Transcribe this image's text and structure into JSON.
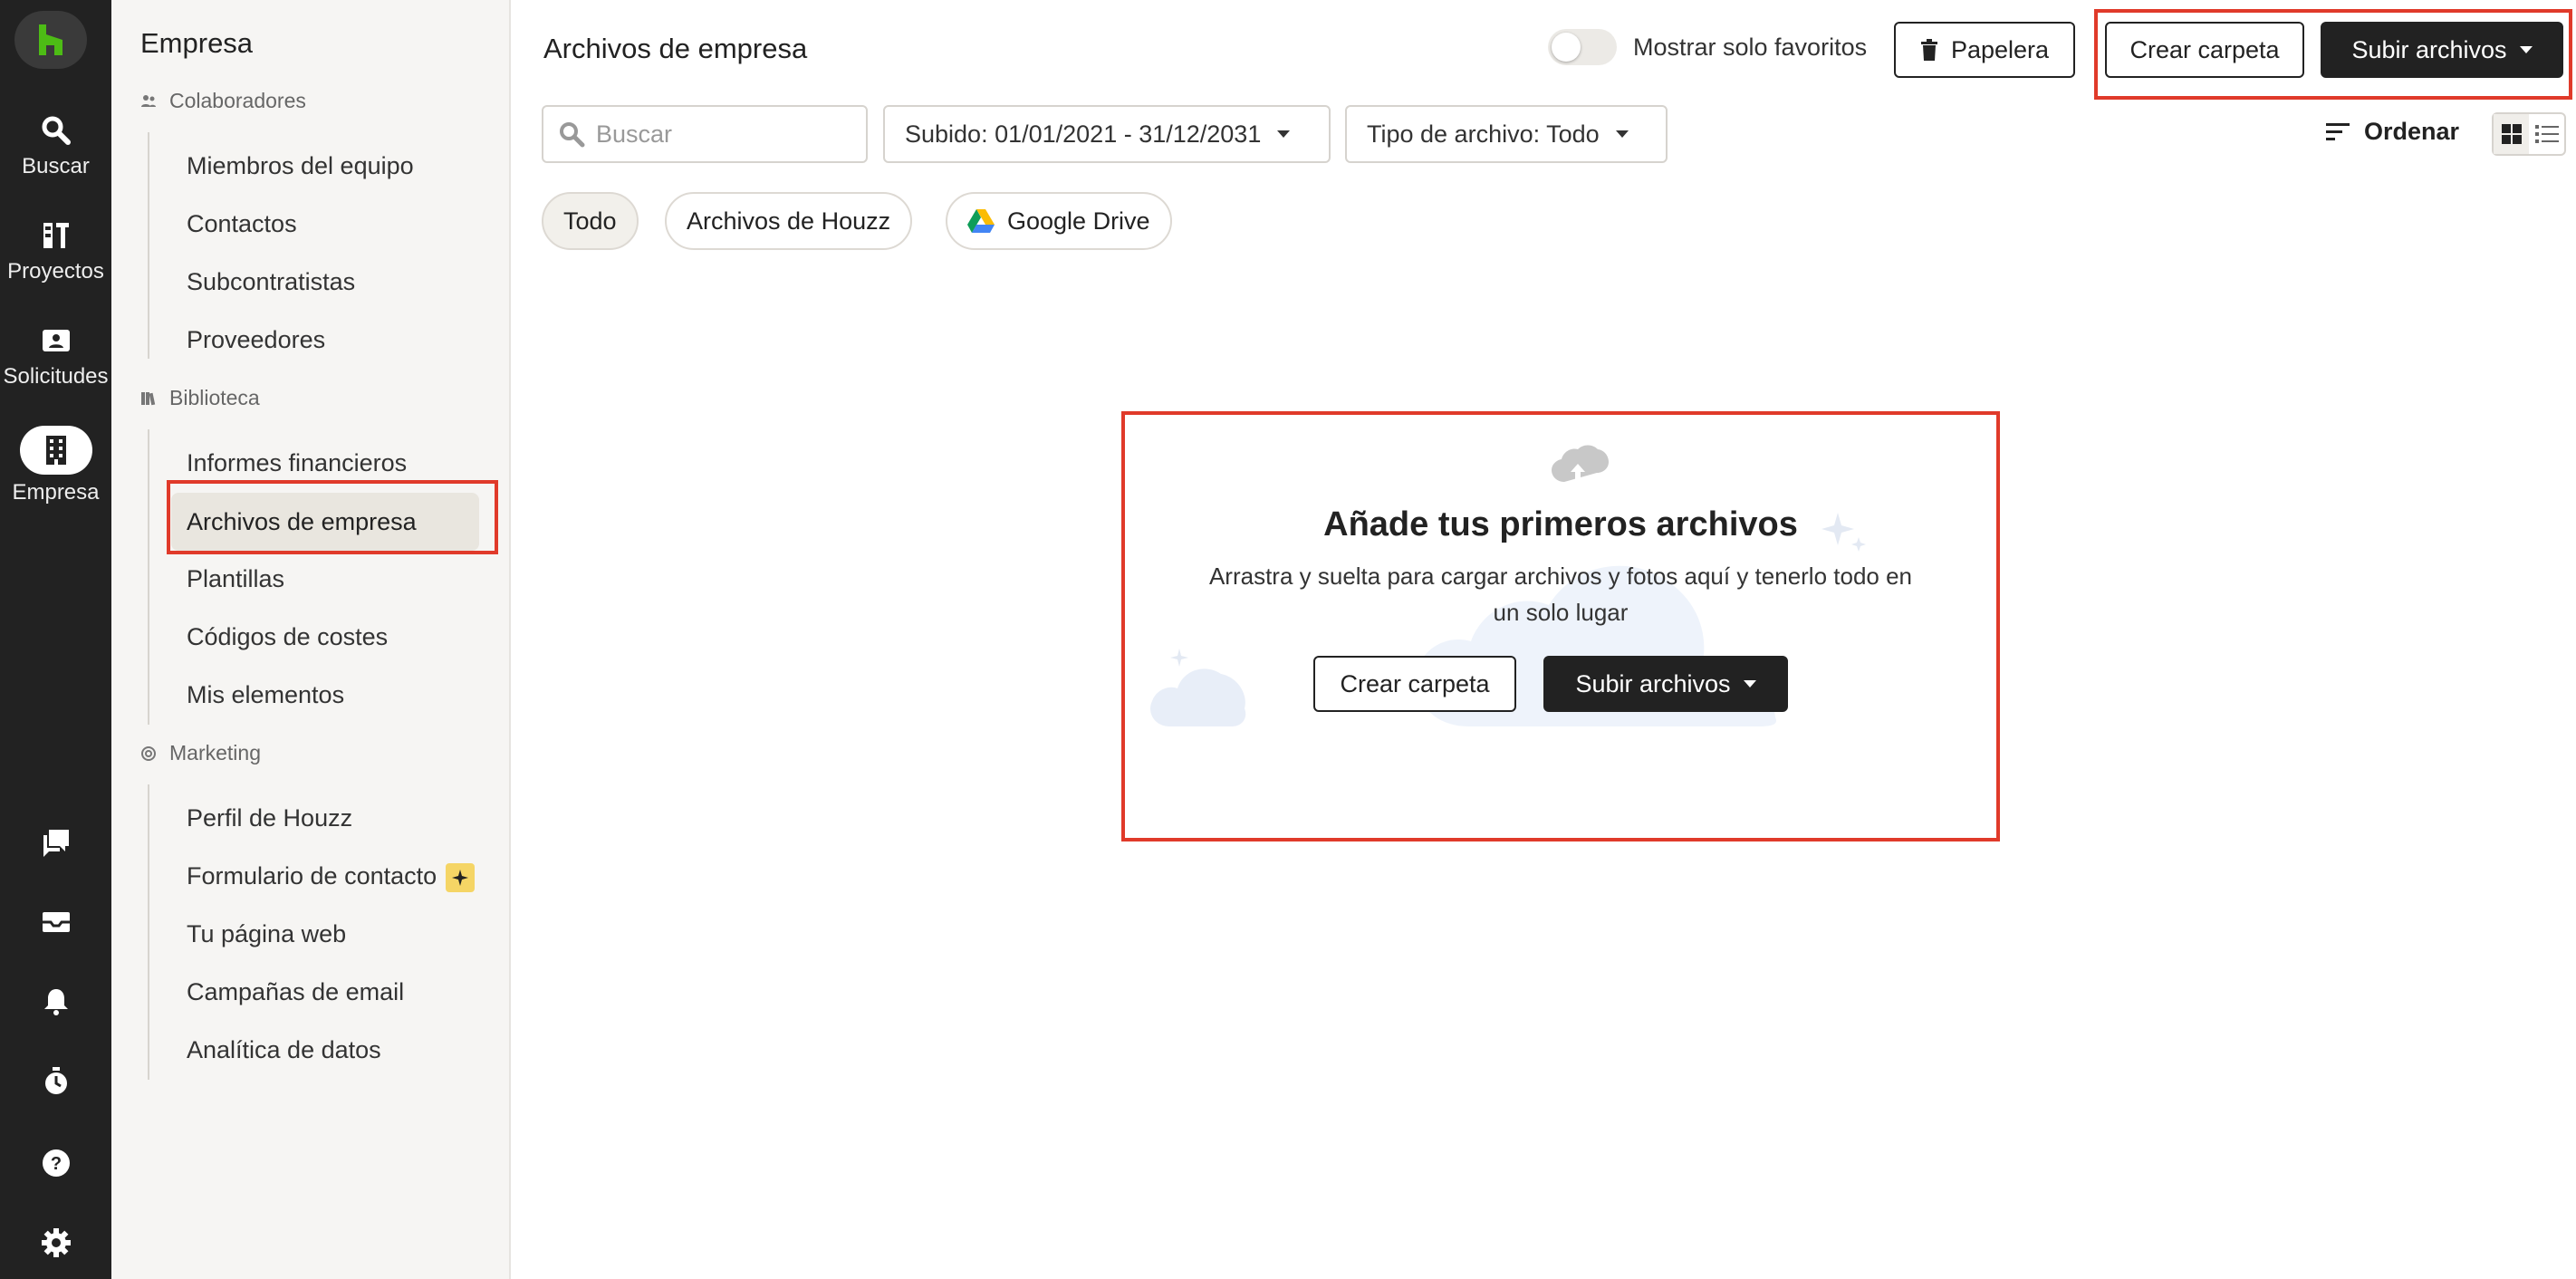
{
  "rail": {
    "items": [
      {
        "label": "Buscar",
        "icon": "search-icon"
      },
      {
        "label": "Proyectos",
        "icon": "projects-icon"
      },
      {
        "label": "Solicitudes",
        "icon": "requests-icon"
      },
      {
        "label": "Empresa",
        "icon": "building-icon",
        "active": true
      }
    ],
    "bottom_icons": [
      "chat-icon",
      "inbox-icon",
      "bell-icon",
      "timer-icon",
      "help-icon",
      "gear-icon"
    ]
  },
  "sidebar": {
    "title": "Empresa",
    "sections": [
      {
        "label": "Colaboradores",
        "items": [
          "Miembros del equipo",
          "Contactos",
          "Subcontratistas",
          "Proveedores"
        ]
      },
      {
        "label": "Biblioteca",
        "items": [
          "Informes financieros",
          "Archivos de empresa",
          "Plantillas",
          "Códigos de costes",
          "Mis elementos"
        ]
      },
      {
        "label": "Marketing",
        "items": [
          "Perfil de Houzz",
          "Formulario de contacto",
          "Tu página web",
          "Campañas de email",
          "Analítica de datos"
        ]
      }
    ]
  },
  "main": {
    "title": "Archivos de empresa",
    "favorites_toggle_label": "Mostrar solo favoritos",
    "trash_label": "Papelera",
    "create_folder_label": "Crear carpeta",
    "upload_label": "Subir archivos",
    "search_placeholder": "Buscar",
    "filter_date": "Subido: 01/01/2021 - 31/12/2031",
    "filter_type": "Tipo de archivo: Todo",
    "sort_label": "Ordenar",
    "chips": [
      "Todo",
      "Archivos de Houzz",
      "Google Drive"
    ],
    "empty": {
      "title": "Añade tus primeros archivos",
      "subtitle": "Arrastra y suelta para cargar archivos y fotos aquí y tenerlo todo en un solo lugar",
      "create_folder_label": "Crear carpeta",
      "upload_label": "Subir archivos"
    }
  },
  "colors": {
    "accent": "#222222",
    "highlight": "#e03a2a",
    "brand": "#4dbc15"
  }
}
